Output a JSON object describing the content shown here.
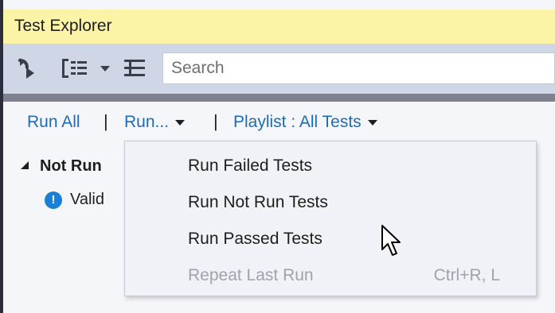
{
  "window": {
    "title": "Test Explorer"
  },
  "toolbar": {
    "run_icon": "run-tests-icon",
    "group_icon": "group-by-icon",
    "dropdown_icon": "chevron-down-icon",
    "playlist_icon": "list-icon",
    "search_placeholder": "Search"
  },
  "commands": {
    "run_all": "Run All",
    "separator": "|",
    "run": "Run...",
    "playlist": "Playlist : All Tests"
  },
  "tree": {
    "group_label": "Not Run",
    "test_label": "Valid",
    "test_icon": "info-icon"
  },
  "run_menu": {
    "items": [
      {
        "label": "Run Failed Tests",
        "enabled": true
      },
      {
        "label": "Run Not Run Tests",
        "enabled": true
      },
      {
        "label": "Run Passed Tests",
        "enabled": true
      },
      {
        "label": "Repeat Last Run",
        "enabled": false,
        "shortcut": "Ctrl+R, L"
      }
    ]
  },
  "colors": {
    "title_bar": "#fbf3a5",
    "toolbar": "#cfd6e5",
    "link": "#1e6bb8",
    "disabled_text": "#a0a3ab",
    "info_icon": "#1b7fd6"
  }
}
